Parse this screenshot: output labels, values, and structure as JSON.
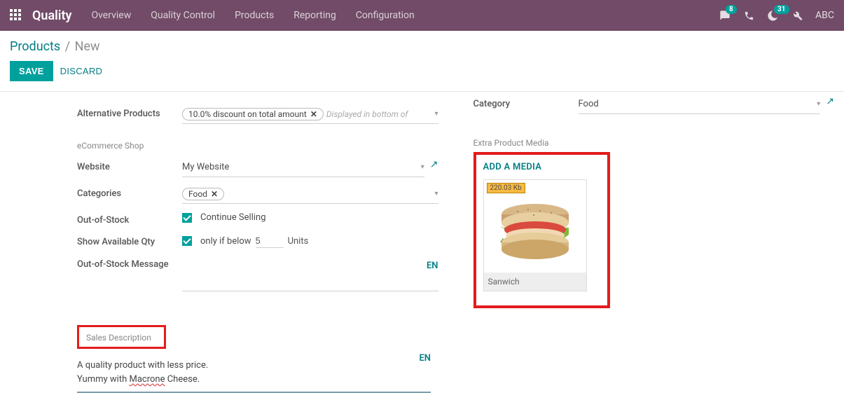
{
  "topbar": {
    "app_name": "Quality",
    "menu": [
      "Overview",
      "Quality Control",
      "Products",
      "Reporting",
      "Configuration"
    ],
    "chat_badge": "8",
    "moon_badge": "31",
    "user_abbr": "ABC"
  },
  "breadcrumb": {
    "root": "Products",
    "sep": "/",
    "current": "New"
  },
  "actions": {
    "save": "SAVE",
    "discard": "DISCARD"
  },
  "left": {
    "alt_products_label": "Alternative Products",
    "alt_products_tag": "10.0% discount on total amount",
    "alt_products_hint": "Displayed in bottom of",
    "ecommerce_section": "eCommerce Shop",
    "website_label": "Website",
    "website_value": "My Website",
    "categories_label": "Categories",
    "categories_tag": "Food",
    "oos_label": "Out-of-Stock",
    "oos_text": "Continue Selling",
    "showqty_label": "Show Available Qty",
    "showqty_text": "only if below",
    "showqty_value": "5",
    "showqty_units": "Units",
    "oos_msg_label": "Out-of-Stock Message",
    "en_btn": "EN",
    "sales_desc_heading": "Sales Description",
    "sales_desc_line1": "A quality product with less price.",
    "sales_desc_line2a": "Yummy with ",
    "sales_desc_misspell": "Macrone",
    "sales_desc_line2b": " Cheese."
  },
  "right": {
    "category_label": "Category",
    "category_value": "Food",
    "extra_media_section": "Extra Product Media",
    "add_media": "ADD A MEDIA",
    "media_size": "220.03 Kb",
    "media_caption": "Sanwich"
  },
  "icons": {
    "x": "✕",
    "caret": "▾",
    "external": "↗"
  }
}
